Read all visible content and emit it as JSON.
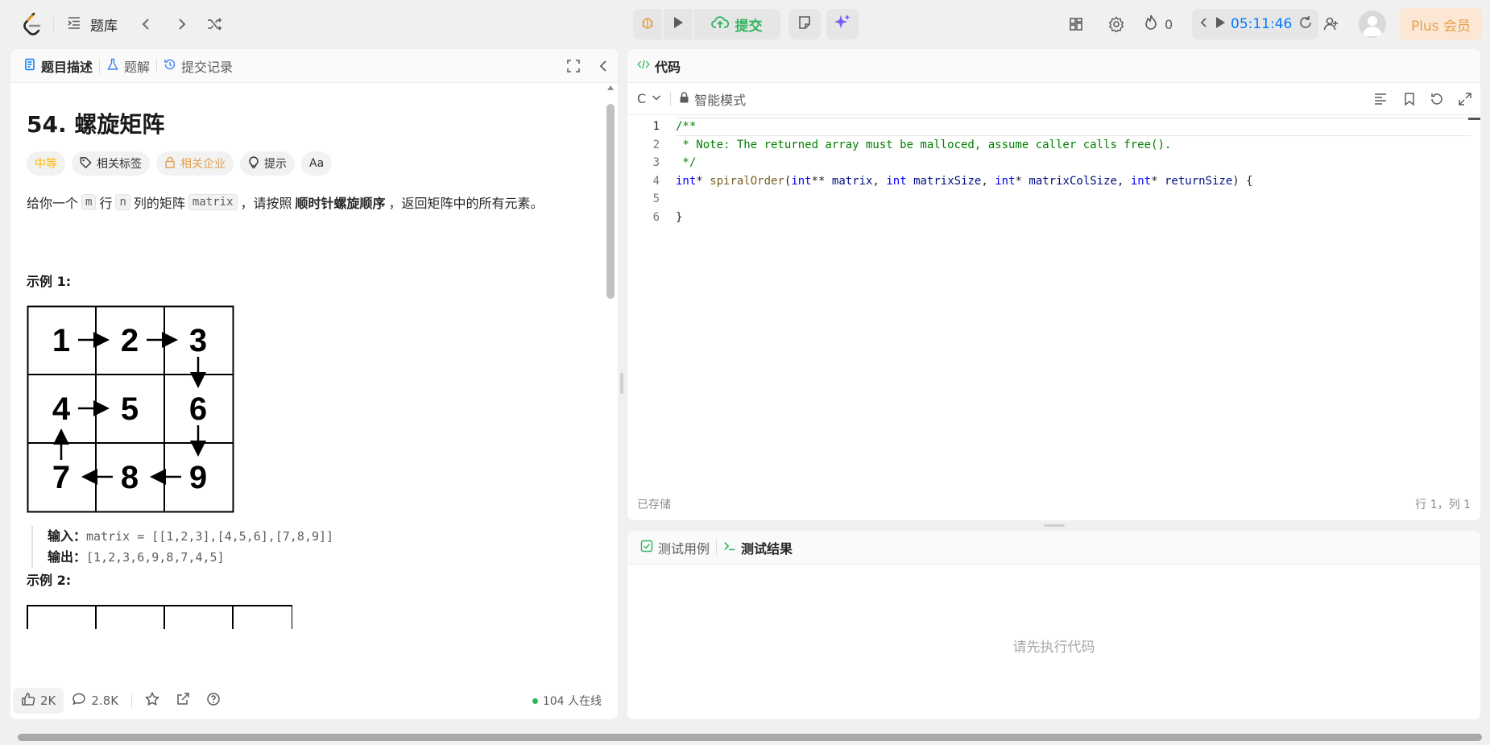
{
  "topbar": {
    "problem_list_label": "题库",
    "submit_label": "提交",
    "streak_count": "0",
    "timer": "05:11:46",
    "plus_label": "Plus 会员"
  },
  "left": {
    "tabs": [
      {
        "label": "题目描述"
      },
      {
        "label": "题解"
      },
      {
        "label": "提交记录"
      }
    ],
    "title": "54. 螺旋矩阵",
    "tags": {
      "difficulty": "中等",
      "related_tags": "相关标签",
      "companies": "相关企业",
      "hint": "提示",
      "font": "Aa"
    },
    "description": {
      "p1": "给你一个",
      "m": "m",
      "p2": "行",
      "n": "n",
      "p3": "列的矩阵",
      "matrix": "matrix",
      "p4": "，请按照",
      "bold": "顺时针螺旋顺序",
      "p5": "，返回矩阵中的所有元素。"
    },
    "example1": {
      "title": "示例 1:",
      "grid": [
        "1",
        "2",
        "3",
        "4",
        "5",
        "6",
        "7",
        "8",
        "9"
      ],
      "input_label": "输入：",
      "input_value": "matrix = [[1,2,3],[4,5,6],[7,8,9]]",
      "output_label": "输出：",
      "output_value": "[1,2,3,6,9,8,7,4,5]"
    },
    "example2": {
      "title": "示例 2:"
    },
    "footer": {
      "likes": "2K",
      "comments": "2.8K",
      "online": "104 人在线"
    }
  },
  "code_panel": {
    "tab_label": "代码",
    "language": "C",
    "mode": "智能模式",
    "lines": [
      {
        "n": "1"
      },
      {
        "n": "2"
      },
      {
        "n": "3"
      },
      {
        "n": "4"
      },
      {
        "n": "5"
      },
      {
        "n": "6"
      }
    ],
    "code": {
      "l1": "/**",
      "l2": " * Note: The returned array must be malloced, assume caller calls free().",
      "l3": " */",
      "l4_kw1": "int",
      "l4_a": "* ",
      "l4_fn": "spiralOrder",
      "l4_b": "(",
      "l4_kw2": "int",
      "l4_c": "** ",
      "l4_v1": "matrix",
      "l4_d": ", ",
      "l4_kw3": "int",
      "l4_e": " ",
      "l4_v2": "matrixSize",
      "l4_f": ", ",
      "l4_kw4": "int",
      "l4_g": "* ",
      "l4_v3": "matrixColSize",
      "l4_h": ", ",
      "l4_kw5": "int",
      "l4_i": "* ",
      "l4_v4": "returnSize",
      "l4_j": ") {",
      "l6": "}"
    },
    "saved": "已存储",
    "cursor": "行 1，列 1"
  },
  "result_panel": {
    "tab_testcase": "测试用例",
    "tab_result": "测试结果",
    "placeholder": "请先执行代码"
  },
  "colors": {
    "accent_green": "#2db55d",
    "difficulty_medium": "#ffb800",
    "timer_blue": "#007aff",
    "plus_orange": "#e5a04d"
  }
}
